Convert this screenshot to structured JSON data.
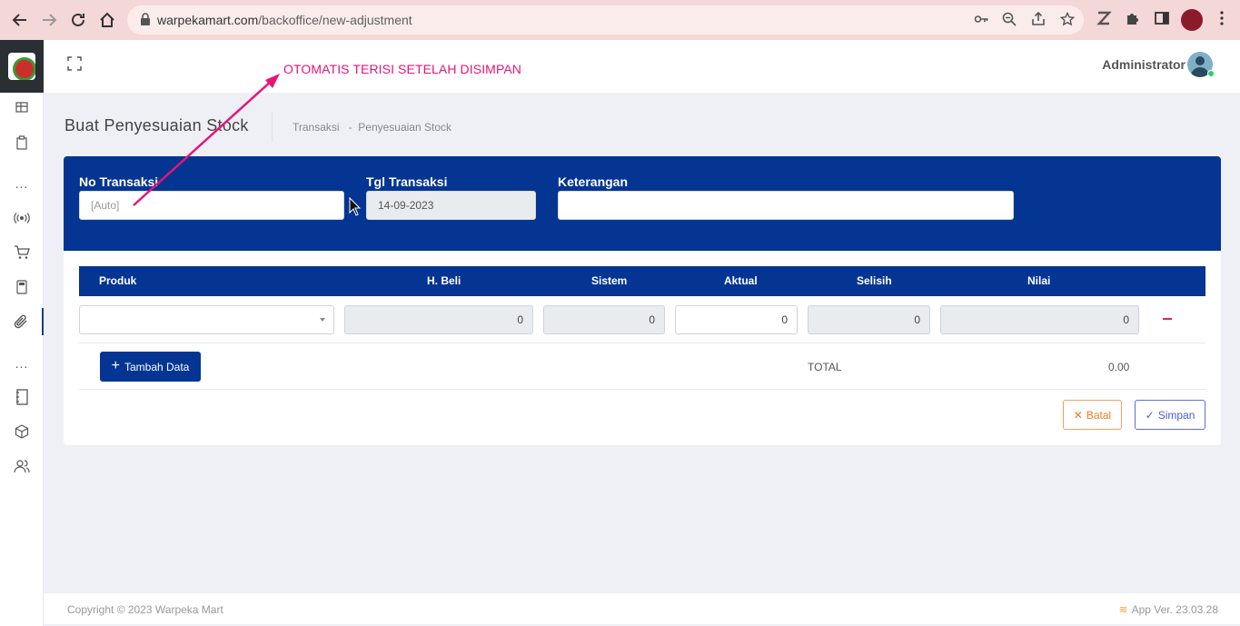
{
  "browser": {
    "url_domain": "warpekamart.com",
    "url_path": "/backoffice/new-adjustment"
  },
  "topbar": {
    "annotation": "OTOMATIS TERISI SETELAH DISIMPAN",
    "user_name": "Administrator"
  },
  "page": {
    "title": "Buat Penyesuaian Stock",
    "breadcrumb": [
      "Transaksi",
      "-",
      "Penyesuaian Stock"
    ]
  },
  "form": {
    "no_transaksi_label": "No Transaksi",
    "no_transaksi_placeholder": "[Auto]",
    "tgl_transaksi_label": "Tgl Transaksi",
    "tgl_transaksi_value": "14-09-2023",
    "keterangan_label": "Keterangan",
    "keterangan_value": ""
  },
  "table": {
    "columns": [
      "Produk",
      "H. Beli",
      "Sistem",
      "Aktual",
      "Selisih",
      "Nilai"
    ],
    "rows": [
      {
        "produk": "",
        "h_beli": "0",
        "sistem": "0",
        "aktual": "0",
        "selisih": "0",
        "nilai": "0"
      }
    ],
    "add_button": "Tambah Data",
    "total_label": "TOTAL",
    "total_value": "0.00"
  },
  "actions": {
    "cancel": "Batal",
    "save": "Simpan"
  },
  "footer": {
    "copyright": "Copyright © 2023 Warpeka Mart",
    "version": "App Ver. 23.03.28"
  },
  "colors": {
    "primary": "#043592",
    "annotation": "#e6147a",
    "cancel": "#f07a20",
    "save": "#4a5fd0"
  }
}
